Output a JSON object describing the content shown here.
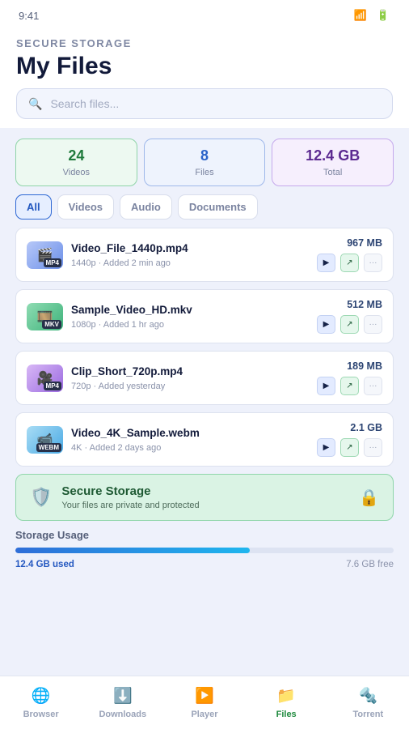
{
  "status": {
    "time": "9:41",
    "wifi_icon": "📶",
    "battery_icon": "🔋"
  },
  "header": {
    "eyebrow": "SECURE STORAGE",
    "title": "My Files"
  },
  "search": {
    "icon": "🔍",
    "placeholder": "Search files..."
  },
  "stats": [
    {
      "value": "24",
      "label": "Videos",
      "color": "#1f7a3c"
    },
    {
      "value": "8",
      "label": "Files",
      "color": "#2a63c9"
    },
    {
      "value": "12.4 GB",
      "label": "Total",
      "color": "#5c2a91"
    }
  ],
  "tabs": [
    "All",
    "Videos",
    "Audio",
    "Documents"
  ],
  "active_tab": "All",
  "files": [
    {
      "icon": "🎬",
      "format": "MP4",
      "name": "Video_File_1440p.mp4",
      "meta": "1440p · Added 2 min ago",
      "size": "967 MB"
    },
    {
      "icon": "🎞️",
      "format": "MKV",
      "name": "Sample_Video_HD.mkv",
      "meta": "1080p · Added 1 hr ago",
      "size": "512 MB"
    },
    {
      "icon": "🎥",
      "format": "MP4",
      "name": "Clip_Short_720p.mp4",
      "meta": "720p · Added yesterday",
      "size": "189 MB"
    },
    {
      "icon": "📹",
      "format": "WEBM",
      "name": "Video_4K_Sample.webm",
      "meta": "4K · Added 2 days ago",
      "size": "2.1 GB"
    }
  ],
  "actions": {
    "play": "▶",
    "share": "↗",
    "more": "···"
  },
  "secure": {
    "shield_icon": "🛡️",
    "title": "Secure Storage",
    "subtitle": "Your files are private and protected",
    "lock_icon": "🔒"
  },
  "usage": {
    "title": "Storage Usage",
    "used": "12.4 GB used",
    "free": "7.6 GB free",
    "used_fraction": 0.62
  },
  "nav": [
    {
      "icon": "🌐",
      "label": "Browser",
      "active": false
    },
    {
      "icon": "⬇️",
      "label": "Downloads",
      "active": false
    },
    {
      "icon": "▶️",
      "label": "Player",
      "active": false
    },
    {
      "icon": "📁",
      "label": "Files",
      "active": true
    },
    {
      "icon": "🔩",
      "label": "Torrent",
      "active": false
    }
  ]
}
